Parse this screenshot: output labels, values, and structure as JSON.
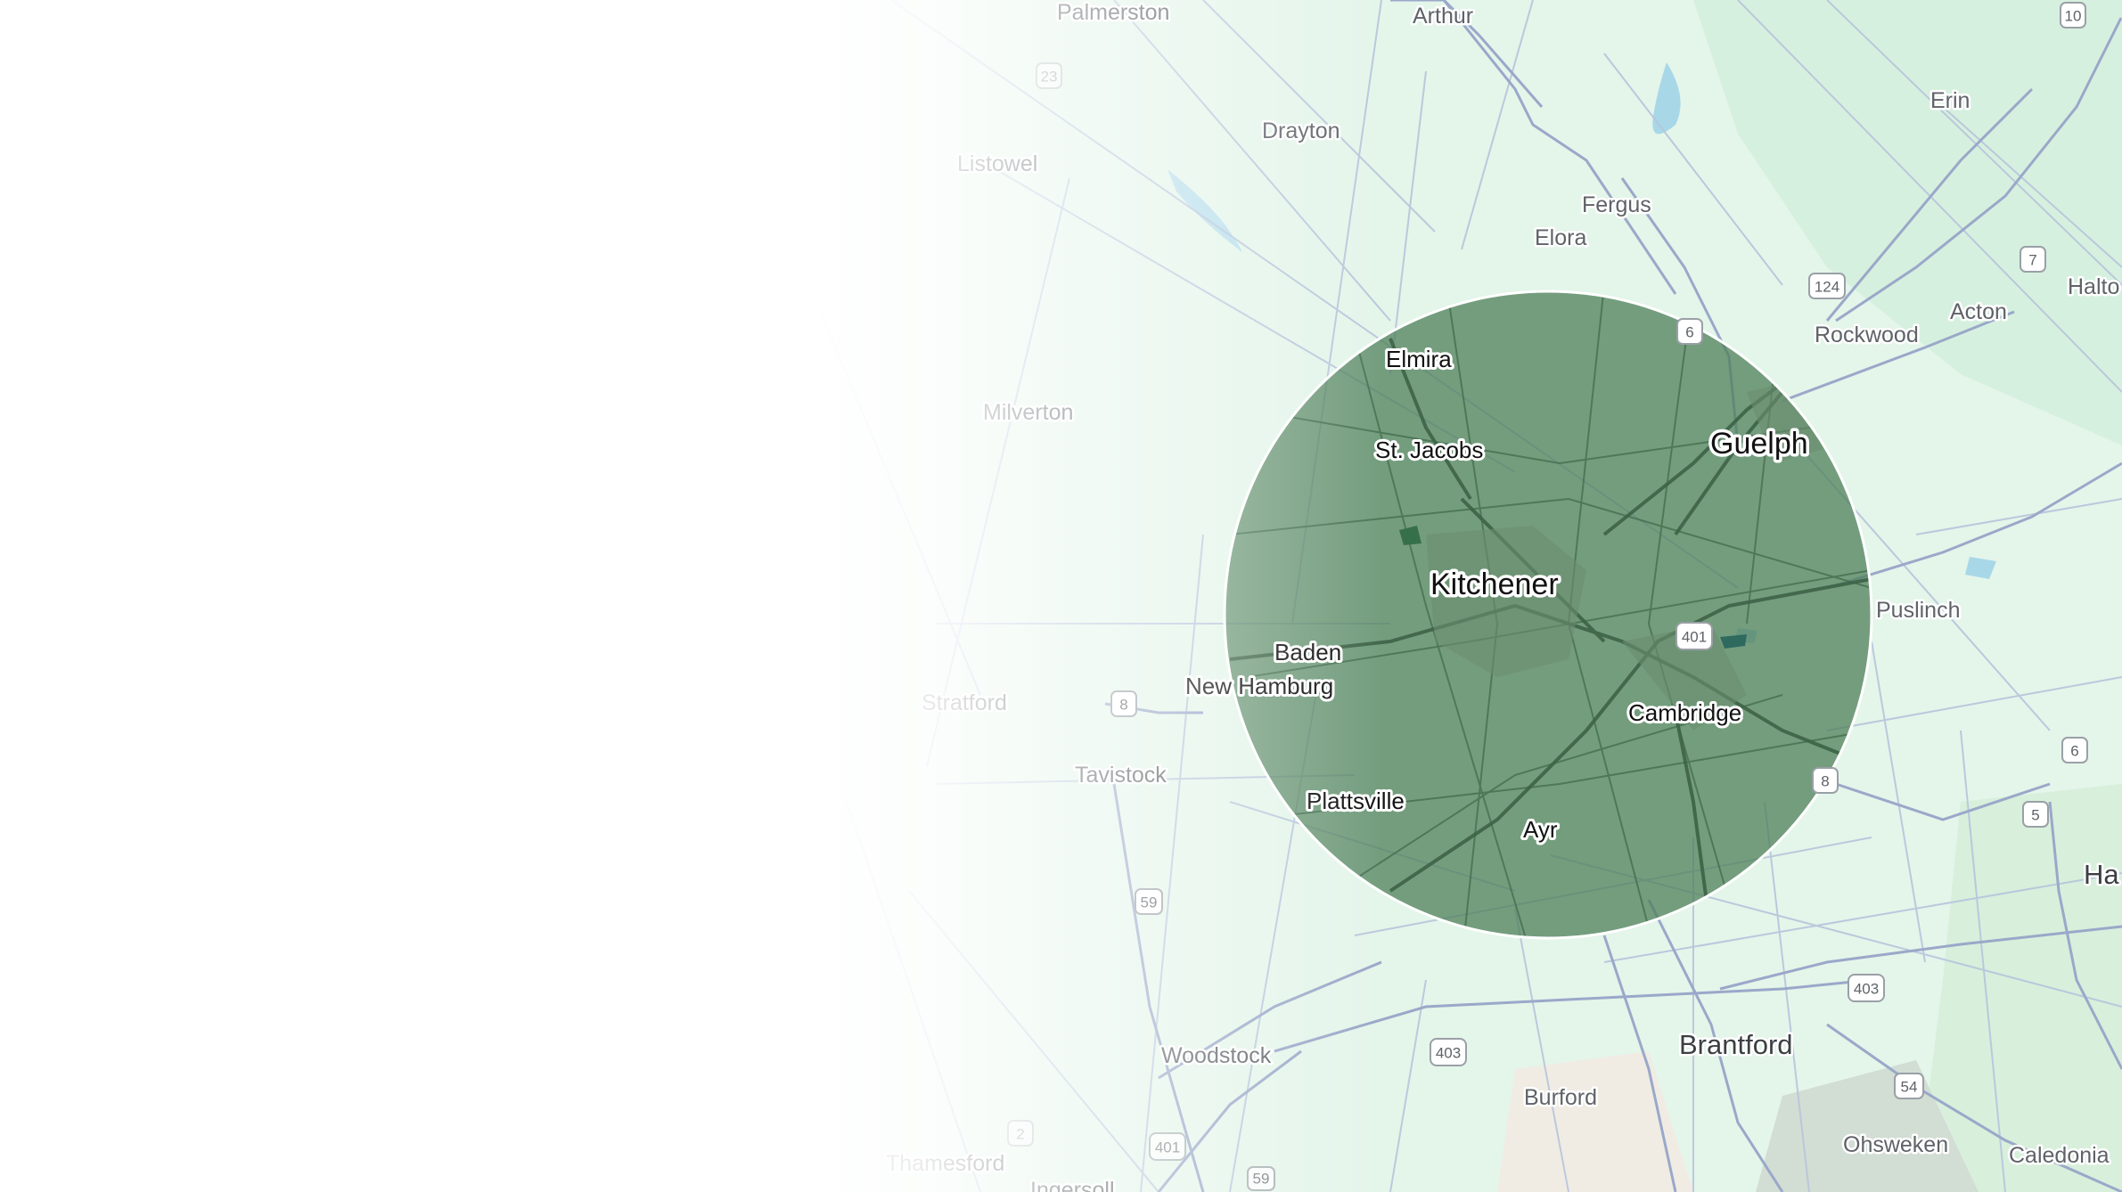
{
  "map": {
    "colors": {
      "land": "#e4f5ea",
      "land_deep": "#d6f0df",
      "road": "#a9b6d0",
      "road_major": "#8e9cbf",
      "water": "#a8d8e8",
      "radius_fill": "#4f7f5a",
      "radius_stroke": "#ffffff"
    },
    "radius_area": {
      "center_label": "Kitchener",
      "opacity": 0.75
    },
    "places_outside": [
      {
        "name": "Palmerston",
        "major": false
      },
      {
        "name": "Arthur",
        "major": false
      },
      {
        "name": "Drayton",
        "major": false
      },
      {
        "name": "Listowel",
        "major": false
      },
      {
        "name": "Fergus",
        "major": false
      },
      {
        "name": "Elora",
        "major": false
      },
      {
        "name": "Erin",
        "major": false
      },
      {
        "name": "Halto",
        "major": false
      },
      {
        "name": "Rockwood",
        "major": false
      },
      {
        "name": "Acton",
        "major": false
      },
      {
        "name": "Milverton",
        "major": false
      },
      {
        "name": "Puslinch",
        "major": false
      },
      {
        "name": "Stratford",
        "major": false
      },
      {
        "name": "Tavistock",
        "major": false
      },
      {
        "name": "Ha",
        "major": true
      },
      {
        "name": "Woodstock",
        "major": false
      },
      {
        "name": "Brantford",
        "major": true
      },
      {
        "name": "Burford",
        "major": false
      },
      {
        "name": "Thamesford",
        "major": false
      },
      {
        "name": "Ingersoll",
        "major": false
      },
      {
        "name": "Ohsweken",
        "major": false
      },
      {
        "name": "Caledonia",
        "major": false
      }
    ],
    "places_inside": [
      {
        "name": "Elmira",
        "major": false
      },
      {
        "name": "St. Jacobs",
        "major": false
      },
      {
        "name": "Guelph",
        "major": true
      },
      {
        "name": "Kitchener",
        "major": true
      },
      {
        "name": "Baden",
        "major": false
      },
      {
        "name": "New Hamburg",
        "major": false
      },
      {
        "name": "Cambridge",
        "major": false
      },
      {
        "name": "Plattsville",
        "major": false
      },
      {
        "name": "Ayr",
        "major": false
      }
    ],
    "highway_shields": [
      "10",
      "23",
      "124",
      "7",
      "6",
      "401",
      "8",
      "6",
      "5",
      "8",
      "59",
      "403",
      "403",
      "54",
      "2",
      "401",
      "59"
    ]
  }
}
